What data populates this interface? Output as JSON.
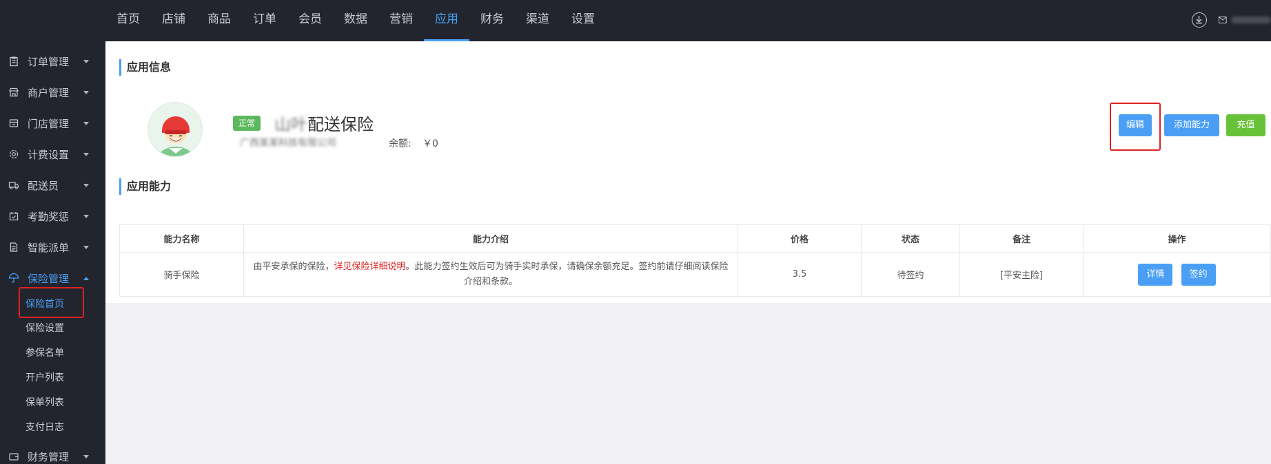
{
  "top_nav": {
    "items": [
      "首页",
      "店铺",
      "商品",
      "订单",
      "会员",
      "数据",
      "营销",
      "应用",
      "财务",
      "渠道",
      "设置"
    ],
    "active": "应用"
  },
  "sidebar": {
    "items": [
      {
        "label": "订单管理",
        "icon": "clipboard-icon"
      },
      {
        "label": "商户管理",
        "icon": "store-icon"
      },
      {
        "label": "门店管理",
        "icon": "shop-icon"
      },
      {
        "label": "计费设置",
        "icon": "gear-icon"
      },
      {
        "label": "配送员",
        "icon": "truck-icon"
      },
      {
        "label": "考勤奖惩",
        "icon": "calendar-icon"
      },
      {
        "label": "智能派单",
        "icon": "document-icon"
      },
      {
        "label": "保险管理",
        "icon": "umbrella-icon"
      },
      {
        "label": "财务管理",
        "icon": "wallet-icon"
      }
    ],
    "open_item": "保险管理",
    "sub_items": [
      "保险首页",
      "保险设置",
      "参保名单",
      "开户列表",
      "保单列表",
      "支付日志"
    ],
    "active_sub": "保险首页"
  },
  "app_info": {
    "section_title": "应用信息",
    "status": "正常",
    "name": "配送保险",
    "balance_label": "余额:",
    "balance_value": "￥0",
    "buttons": {
      "edit": "编辑",
      "add_capability": "添加能力",
      "recharge": "充值"
    }
  },
  "capabilities": {
    "section_title": "应用能力",
    "columns": [
      "能力名称",
      "能力介绍",
      "价格",
      "状态",
      "备注",
      "操作"
    ],
    "rows": [
      {
        "name": "骑手保险",
        "intro_prefix": "由平安承保的保险，",
        "intro_link": "详见保险详细说明",
        "intro_suffix": "。此能力签约生效后可为骑手实时承保，请确保余额充足。签约前请仔细阅读保险介绍和条款。",
        "price": "3.5",
        "status": "待签约",
        "remark": "[平安主险]",
        "actions": {
          "detail": "详情",
          "sign": "签约"
        }
      }
    ]
  },
  "colors": {
    "accent": "#4a9ff5",
    "dark_bg": "#23252e",
    "success": "#5cb85c",
    "highlight": "#e02020"
  }
}
